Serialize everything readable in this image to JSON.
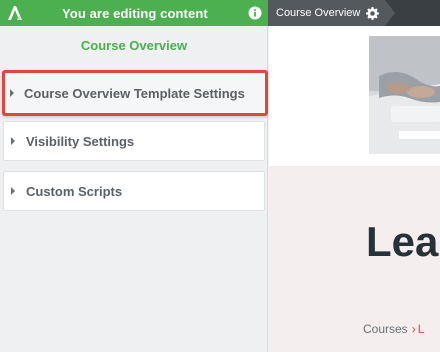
{
  "topbar": {
    "editing_message": "You are editing content",
    "page_crumb": "Course Overview"
  },
  "sidebar": {
    "title": "Course Overview",
    "panels": [
      {
        "label": "Course Overview Template Settings",
        "highlighted": true
      },
      {
        "label": "Visibility Settings"
      },
      {
        "label": "Custom Scripts"
      }
    ]
  },
  "preview": {
    "heading": "Lea",
    "breadcrumb": {
      "root": "Courses",
      "separator": "›",
      "current": "L"
    }
  },
  "colors": {
    "accent_green": "#4caf50",
    "highlight_red": "#e0463d",
    "topbar_dark": "#3a3f44",
    "heading_dark": "#263238"
  },
  "icons": [
    "app-logo-icon",
    "info-icon",
    "gear-icon",
    "caret-right-icon"
  ]
}
